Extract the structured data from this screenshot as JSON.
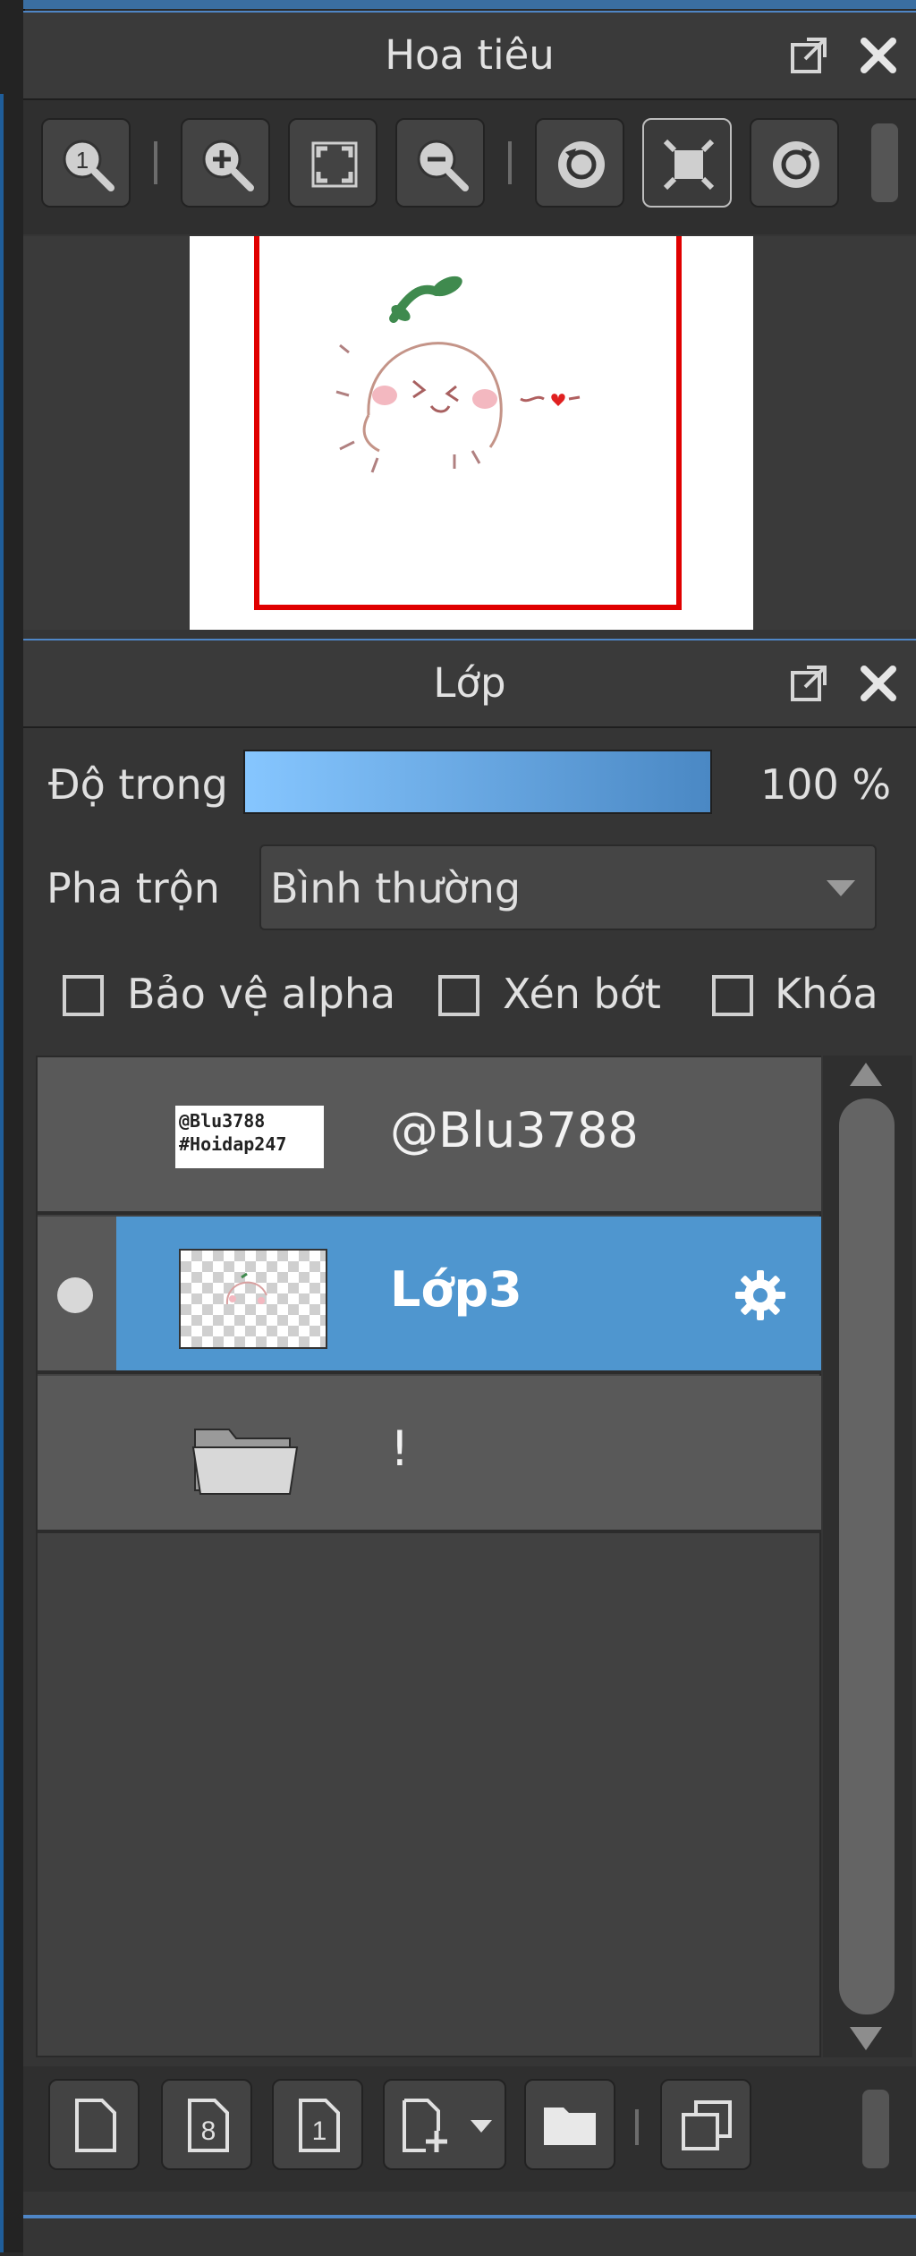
{
  "navigator": {
    "title": "Hoa tiêu",
    "toolbar": [
      "zoom-100-icon",
      "zoom-in-icon",
      "fit-screen-icon",
      "zoom-out-icon",
      "rotate-left-icon",
      "fullscreen-icon",
      "rotate-right-icon"
    ]
  },
  "layers_panel": {
    "title": "Lớp",
    "opacity_label": "Độ trong",
    "opacity_value": "100 %",
    "opacity_level": 1.0,
    "blend_label": "Pha trộn",
    "blend_value": "Bình thường",
    "checkbox_alpha": "Bảo vệ alpha",
    "checkbox_clip": "Xén bớt",
    "checkbox_lock": "Khóa",
    "layers": [
      {
        "name": "@Blu3788",
        "thumb_text_line1": "@Blu3788",
        "thumb_text_line2": "#Hoidap247"
      },
      {
        "name": "Lớp3",
        "selected": true
      },
      {
        "name": "!"
      }
    ],
    "bottom_buttons": [
      "new-layer-icon",
      "new-8bit-layer-icon",
      "new-1bit-layer-icon",
      "add-layer-dropdown-icon",
      "new-folder-icon",
      "duplicate-layer-icon"
    ]
  },
  "colors": {
    "accent": "#4f96cf",
    "panel_bg": "#353535",
    "selection_frame": "#e00000"
  }
}
